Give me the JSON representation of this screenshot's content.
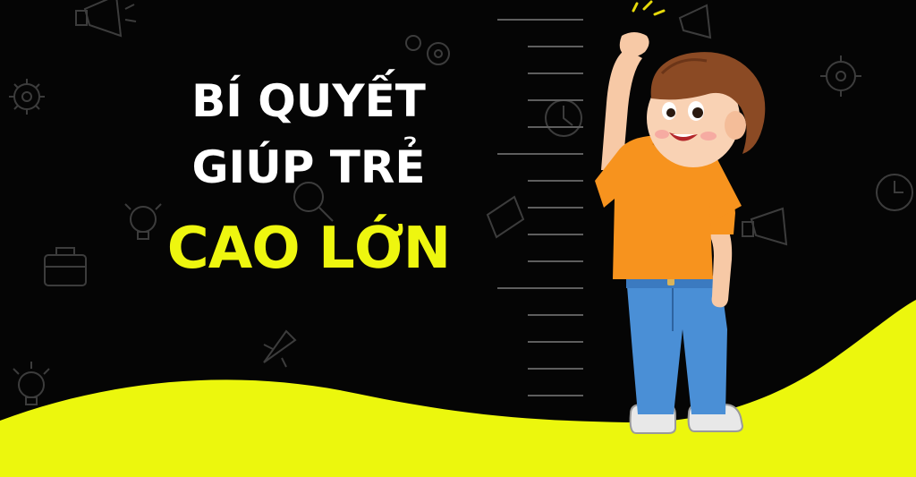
{
  "banner": {
    "headline": {
      "line1": "BÍ QUYẾT",
      "line2": "GIÚP TRẺ",
      "line3": "CAO LỚN"
    }
  },
  "colors": {
    "background": "#050505",
    "headline_white": "#ffffff",
    "headline_yellow": "#eef60f",
    "wave_yellow": "#ecf70d",
    "ruler_ticks": "#5a5a5a",
    "shirt": "#f7931e",
    "jeans": "#4a8fd6",
    "hair": "#8b4a24"
  },
  "illustration": {
    "subject": "boy-measuring-height-icon",
    "background_pattern": "doodle-icons"
  }
}
